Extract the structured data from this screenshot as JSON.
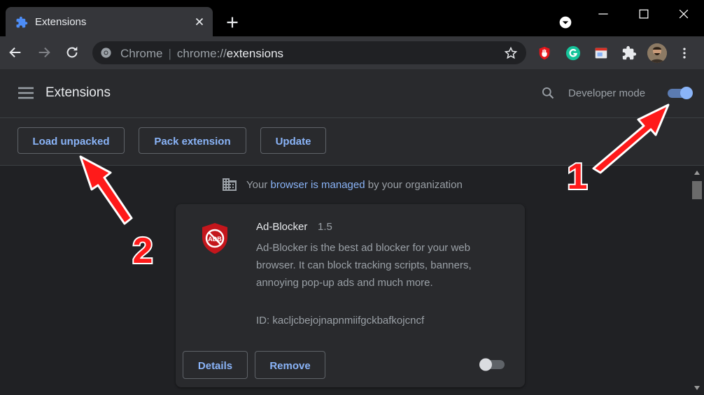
{
  "tab": {
    "title": "Extensions",
    "icon": "puzzle-icon"
  },
  "toolbar": {
    "omnibox_label": "Chrome",
    "omnibox_separator": "|",
    "url_scheme": "chrome://",
    "url_host": "extensions"
  },
  "header": {
    "title": "Extensions",
    "developer_mode_label": "Developer mode",
    "developer_mode_on": true
  },
  "devbar": {
    "load_unpacked": "Load unpacked",
    "pack_extension": "Pack extension",
    "update": "Update"
  },
  "managed": {
    "prefix": "Your ",
    "link": "browser is managed",
    "suffix": " by your organization"
  },
  "extension": {
    "name": "Ad-Blocker",
    "version": "1.5",
    "description": "Ad-Blocker is the best ad blocker for your web browser. It can block tracking scripts, banners, annoying pop-up ads and much more.",
    "id_text": "ID: kacljcbejojnapnmiifgckbafkojcncf",
    "details_label": "Details",
    "remove_label": "Remove",
    "enabled": false
  },
  "annotations": {
    "one": "1",
    "two": "2",
    "arrow_color": "#ff1a1a"
  }
}
